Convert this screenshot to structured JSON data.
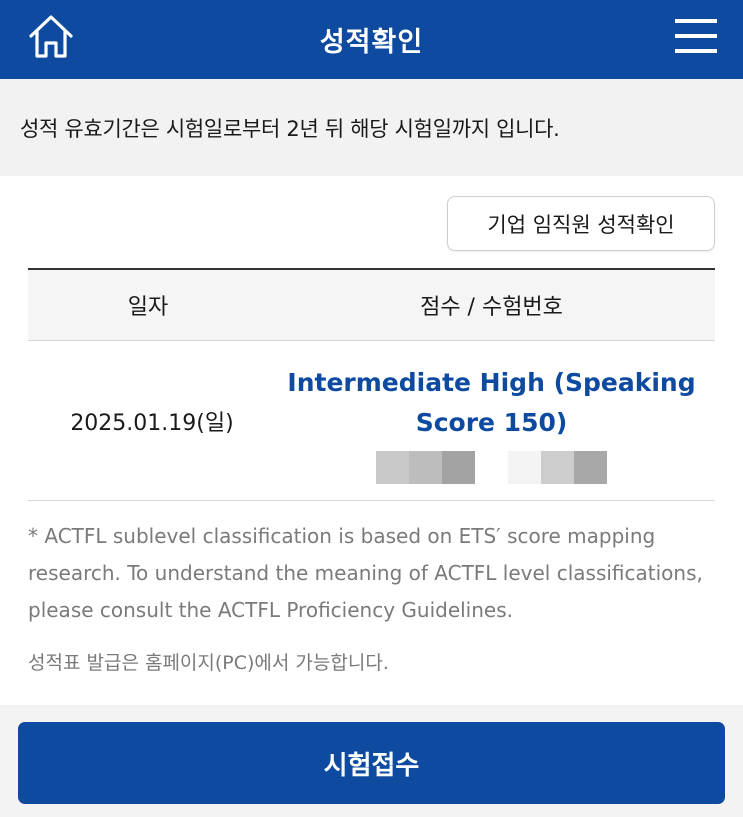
{
  "header": {
    "title": "성적확인",
    "home_icon": "home-icon",
    "menu_icon": "hamburger-menu-icon",
    "background": "#0d4aa0"
  },
  "notice": {
    "text": "성적 유효기간은 시험일로부터 2년 뒤 해당 시험일까지 입니다."
  },
  "corporate_button": {
    "label": "기업 임직원 성적확인"
  },
  "table": {
    "headers": [
      "일자",
      "점수 / 수험번호"
    ],
    "rows": [
      {
        "date": "2025.01.19(일)",
        "score": "Intermediate High (Speaking Score 150)",
        "exam_number_masked": true
      }
    ]
  },
  "footnote": "* ACTFL sublevel classification is based on ETS′ score mapping research. To understand the meaning of ACTFL level classifications, please consult the ACTFL Proficiency Guidelines.",
  "pc_note": "성적표 발급은 홈페이지(PC)에서 가능합니다.",
  "apply_button": {
    "label": "시험접수"
  },
  "colors": {
    "brand": "#0d4aa0",
    "muted_text": "#7a7a7a"
  }
}
